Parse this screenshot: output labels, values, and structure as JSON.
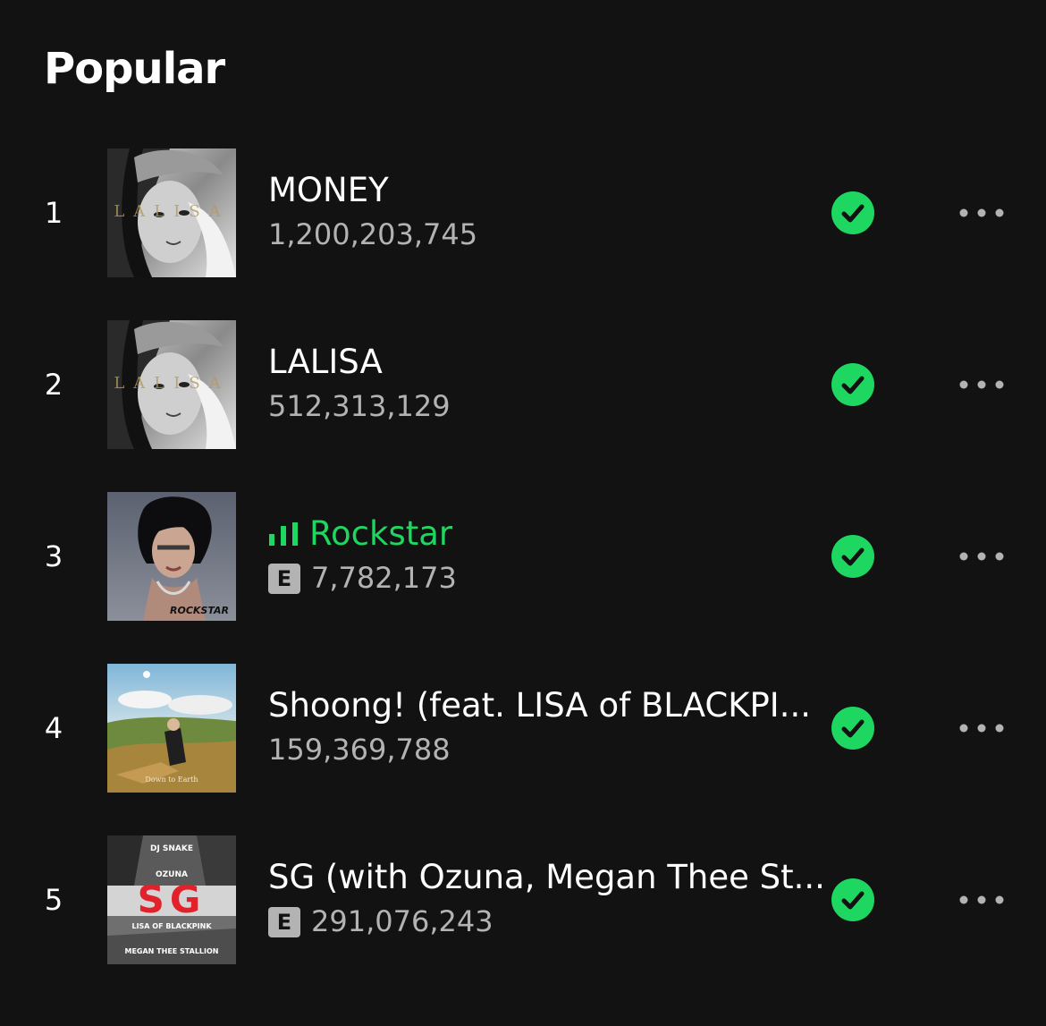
{
  "section": {
    "title": "Popular"
  },
  "colors": {
    "background": "#121212",
    "accent": "#1ed760",
    "muted": "#b3b3b3"
  },
  "tracks": [
    {
      "rank": "1",
      "title": "MONEY",
      "plays": "1,200,203,745",
      "explicit": false,
      "playing": false,
      "saved": true,
      "cover_text": "LALISA"
    },
    {
      "rank": "2",
      "title": "LALISA",
      "plays": "512,313,129",
      "explicit": false,
      "playing": false,
      "saved": true,
      "cover_text": "LALISA"
    },
    {
      "rank": "3",
      "title": "Rockstar",
      "plays": "7,782,173",
      "explicit": true,
      "explicit_label": "E",
      "playing": true,
      "saved": true,
      "cover_text": "ROCKSTAR"
    },
    {
      "rank": "4",
      "title": "Shoong! (feat. LISA of BLACKPI...",
      "plays": "159,369,788",
      "explicit": false,
      "playing": false,
      "saved": true,
      "cover_text": "Down to Earth"
    },
    {
      "rank": "5",
      "title": "SG (with Ozuna, Megan Thee St...",
      "plays": "291,076,243",
      "explicit": true,
      "explicit_label": "E",
      "playing": false,
      "saved": true,
      "cover_lines": [
        "DJ SNAKE",
        "OZUNA",
        "SG",
        "LISA OF BLACKPINK",
        "MEGAN THEE STALLION"
      ]
    }
  ],
  "icons": {
    "saved": "check-circle-icon",
    "more": "more-options-icon",
    "playing": "equalizer-icon"
  }
}
